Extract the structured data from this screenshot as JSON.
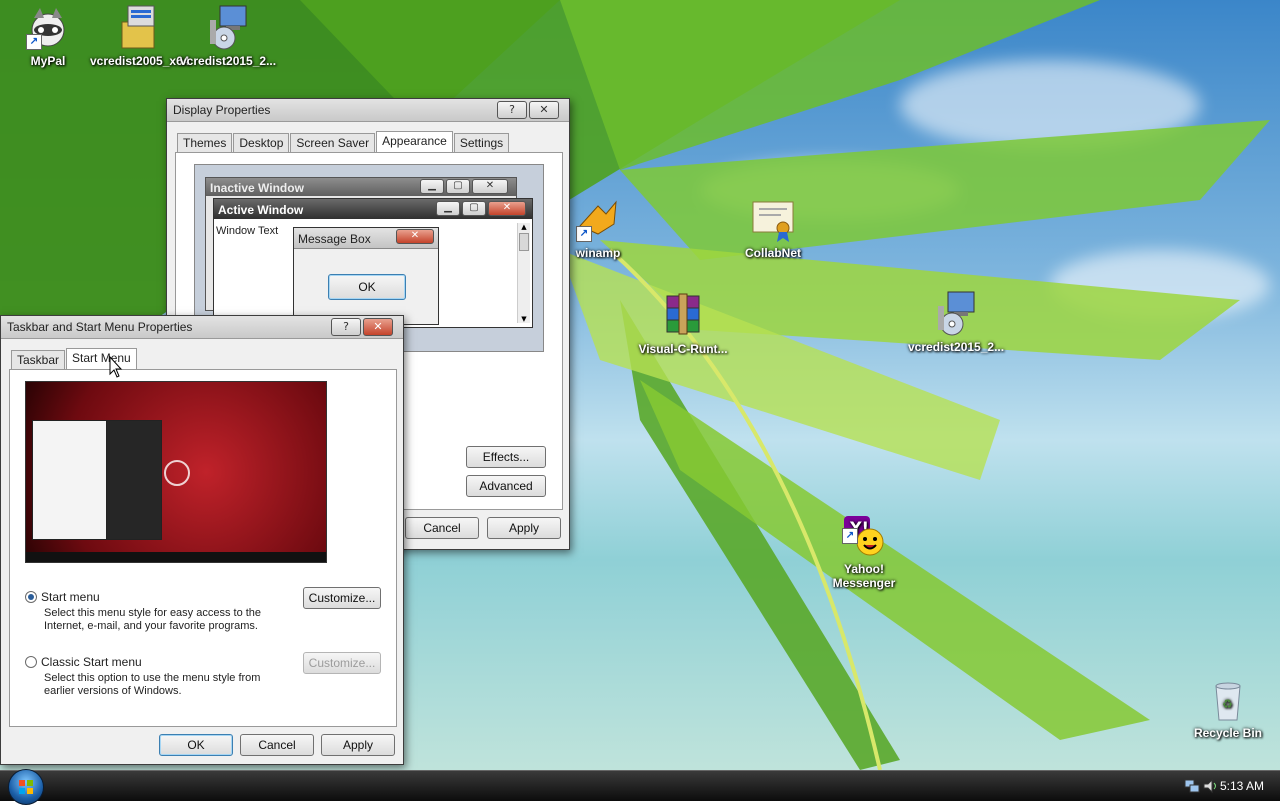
{
  "desktop": {
    "icons": [
      {
        "label": "MyPal"
      },
      {
        "label": "vcredist2005_x64"
      },
      {
        "label": "vcredist2015_2..."
      },
      {
        "label": "winamp"
      },
      {
        "label": "CollabNet"
      },
      {
        "label": "Visual-C-Runt..."
      },
      {
        "label": "vcredist2015_2..."
      },
      {
        "label": "Yahoo!\nMessenger"
      },
      {
        "label": "Recycle Bin"
      }
    ]
  },
  "display_properties": {
    "title": "Display Properties",
    "help_btn": "?",
    "close_btn": "✕",
    "tabs": [
      "Themes",
      "Desktop",
      "Screen Saver",
      "Appearance",
      "Settings"
    ],
    "preview": {
      "inactive_title": "Inactive Window",
      "active_title": "Active Window",
      "window_text": "Window Text",
      "message_box_title": "Message Box",
      "message_ok": "OK"
    },
    "effects_button": "Effects...",
    "advanced_button": "Advanced",
    "cancel_button": "Cancel",
    "apply_button": "Apply"
  },
  "taskbar_properties": {
    "title": "Taskbar and Start Menu Properties",
    "help_btn": "?",
    "close_btn": "✕",
    "tabs": [
      "Taskbar",
      "Start Menu"
    ],
    "options": [
      {
        "label": "Start menu",
        "desc1": "Select this menu style for easy access to the",
        "desc2": "Internet, e-mail, and your favorite programs.",
        "button": "Customize...",
        "selected": true
      },
      {
        "label": "Classic Start menu",
        "desc1": "Select this option to use the menu style from",
        "desc2": "earlier versions of Windows.",
        "button": "Customize...",
        "selected": false
      }
    ],
    "ok_button": "OK",
    "cancel_button": "Cancel",
    "apply_button": "Apply"
  },
  "taskbar": {
    "clock": "5:13 AM"
  }
}
